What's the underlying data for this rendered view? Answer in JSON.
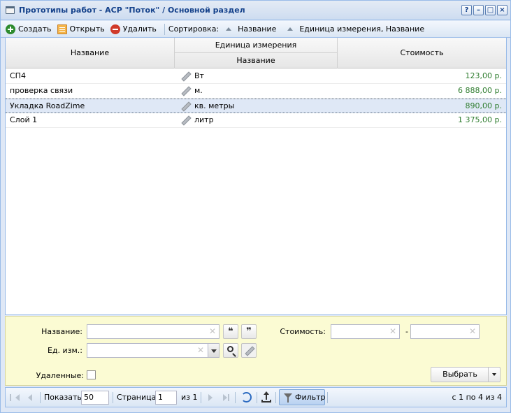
{
  "window": {
    "title": "Прототипы работ - АСР \"Поток\" / Основной раздел",
    "buttons": [
      "?",
      "–",
      "□",
      "×"
    ]
  },
  "toolbar": {
    "create_label": "Создать",
    "open_label": "Открыть",
    "delete_label": "Удалить",
    "sort_label": "Сортировка:",
    "sort_items": [
      "Название",
      "Единица измерения, Название"
    ]
  },
  "grid": {
    "columns": {
      "name": "Название",
      "unit_group": "Единица измерения",
      "unit_name": "Название",
      "cost": "Стоимость"
    },
    "rows": [
      {
        "name": "СП4",
        "unit": "Вт",
        "cost": "123,00 р."
      },
      {
        "name": "проверка связи",
        "unit": "м.",
        "cost": "6 888,00 р."
      },
      {
        "name": "Укладка RoadZime",
        "unit": "кв. метры",
        "cost": "890,00 р."
      },
      {
        "name": "Слой 1",
        "unit": "литр",
        "cost": "1 375,00 р."
      }
    ],
    "selected_row": 2
  },
  "filter": {
    "name_label": "Название:",
    "name_value": "",
    "unit_label": "Ед. изм.:",
    "unit_value": "",
    "cost_label": "Стоимость:",
    "cost_from": "",
    "cost_dash": "-",
    "cost_to": "",
    "deleted_label": "Удаленные:",
    "deleted_checked": false,
    "quote_open": "❝",
    "quote_close": "❞",
    "select_label": "Выбрать"
  },
  "paging": {
    "show_label": "Показать",
    "page_size": "50",
    "page_label": "Страница",
    "page": "1",
    "of_label": "из 1",
    "filter_label": "Фильтр",
    "summary": "с 1 по 4 из 4"
  },
  "colors": {
    "accent": "#15428b",
    "cost_text": "#2f7d2f",
    "filter_bg": "#fbfbd3"
  }
}
